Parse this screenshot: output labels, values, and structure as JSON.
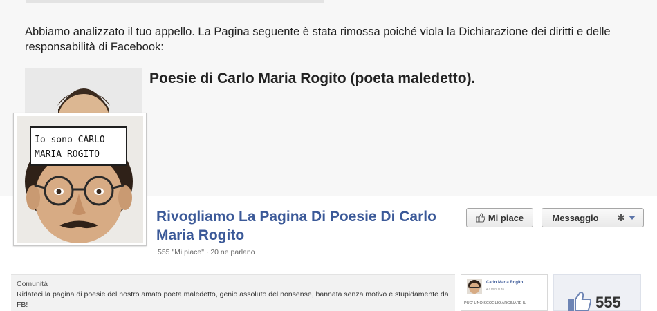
{
  "notice": {
    "message": "Abbiamo analizzato il tuo appello. La Pagina seguente è stata rimossa poiché viola la Dichiarazione dei diritti e delle responsabilità di Facebook:",
    "removed_page_title": "Poesie di Carlo Maria Rogito (poeta maledetto)."
  },
  "page": {
    "sign_line1": "Io sono CARLO",
    "sign_line2": "MARIA ROGITO",
    "title": "Rivogliamo La Pagina Di Poesie Di Carlo Maria Rogito",
    "stats": "555 \"Mi piace\" · 20 ne parlano",
    "like_button": "Mi piace",
    "message_button": "Messaggio",
    "like_icon": "thumbs-up-icon",
    "settings_icon": "gear-icon",
    "dropdown_icon": "chevron-down-icon"
  },
  "about": {
    "category": "Comunità",
    "description": "Ridateci la pagina di poesie del nostro amato poeta maledetto, genio assoluto del nonsense, bannata senza motivo e stupidamente da FB!"
  },
  "post": {
    "author": "Carlo Maria Rogito",
    "time": "47 minuti fa",
    "text": "PUO' UNO SCOGLIO ARGINARE IL"
  },
  "likes": {
    "count": "555",
    "icon": "thumbs-up-icon"
  },
  "colors": {
    "link_blue": "#3b5998",
    "panel_gray": "#f7f7f7"
  }
}
